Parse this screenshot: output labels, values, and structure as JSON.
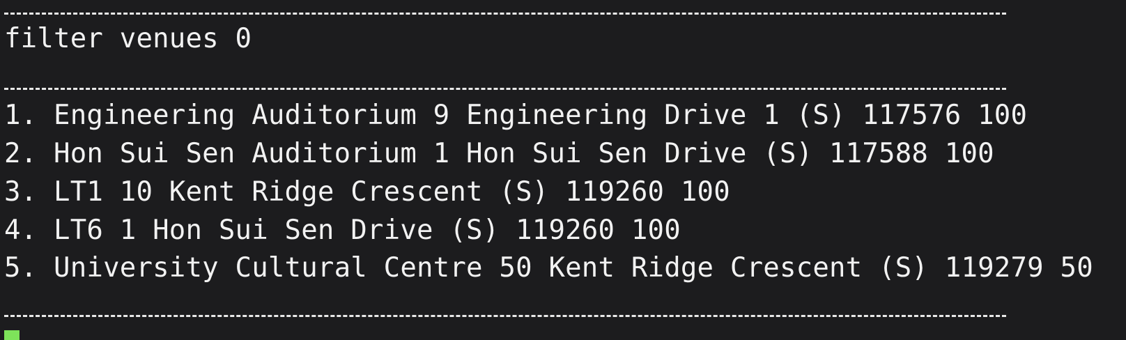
{
  "terminal": {
    "command": "filter venues 0",
    "results": [
      "1. Engineering Auditorium 9 Engineering Drive 1 (S) 117576 100",
      "2. Hon Sui Sen Auditorium 1 Hon Sui Sen Drive (S) 117588 100",
      "3. LT1 10 Kent Ridge Crescent (S) 119260 100",
      "4. LT6 1 Hon Sui Sen Drive (S) 119260 100",
      "5. University Cultural Centre 50 Kent Ridge Crescent (S) 119279 50"
    ]
  },
  "colors": {
    "background": "#1c1c1e",
    "text": "#f2f2f2",
    "cursor": "#7ee35a"
  }
}
